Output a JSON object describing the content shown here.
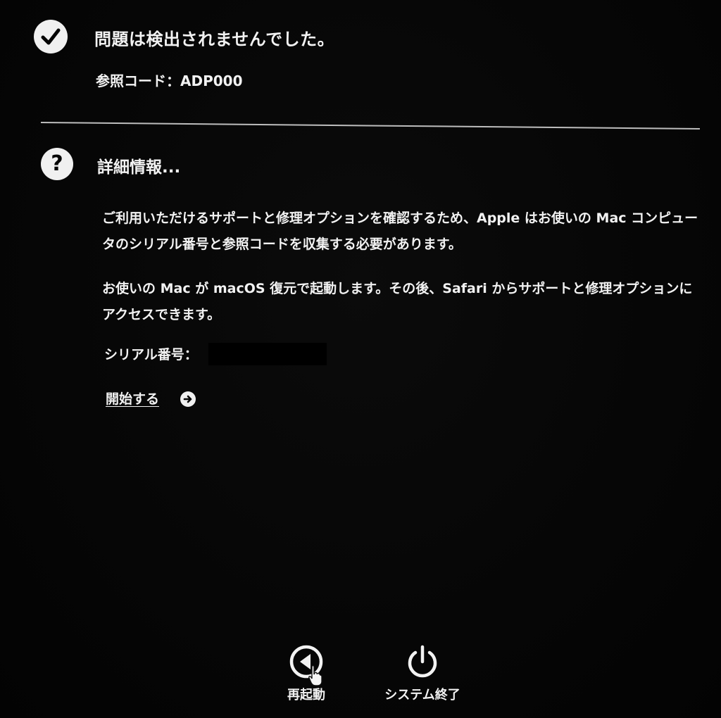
{
  "status": {
    "icon": "checkmark-circle-icon",
    "title": "問題は検出されませんでした。",
    "reference_code": "参照コード：ADP000"
  },
  "info": {
    "icon": "question-circle-icon",
    "title": "詳細情報...",
    "paragraph_1": "ご利用いただけるサポートと修理オプションを確認するため、Apple はお使いの Mac コンピュータのシリアル番号と参照コードを収集する必要があります。",
    "paragraph_2": "お使いの Mac が macOS 復元で起動します。その後、Safari からサポートと修理オプションにアクセスできます。",
    "serial_label": "シリアル番号：",
    "start_link": "開始する",
    "start_icon": "arrow-right-circle-icon"
  },
  "footer": {
    "restart_icon": "restart-icon",
    "restart_label": "再起動",
    "shutdown_icon": "power-icon",
    "shutdown_label": "システム終了"
  },
  "colors": {
    "background": "#050505",
    "text": "#f2f2f2",
    "divider": "#bdbdbd"
  }
}
